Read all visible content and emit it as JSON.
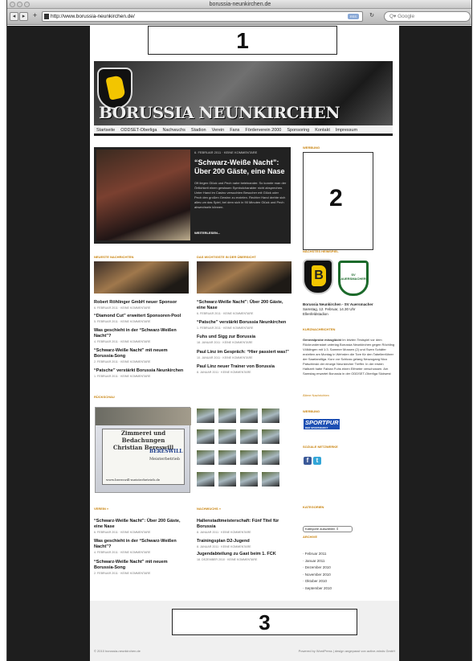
{
  "window": {
    "title": "borussia-neunkirchen.de"
  },
  "toolbar": {
    "url": "http://www.borussia-neunkirchen.de/",
    "rss_label": "RSS",
    "search_placeholder": "Q▾ Google"
  },
  "markers": {
    "one": "1",
    "two": "2",
    "three": "3"
  },
  "site": {
    "brand": "BORUSSIA NEUNKIRCHEN"
  },
  "nav": [
    "Startseite",
    "ODDSET-Oberliga",
    "Nachwuchs",
    "Stadion",
    "Verein",
    "Fans",
    "Förderverein 2000",
    "Sponsoring",
    "Kontakt",
    "Impressum"
  ],
  "featured": {
    "meta": "6. FEBRUAR 2011 · KEINE KOMMENTARE",
    "title": "“Schwarz-Weiße Nacht”: Über 200 Gäste, eine Nase",
    "excerpt": "Oft liegen Glück und Pech nahe beieinander. So konnte man der Örtlichkeit einen gewissen Symbolcharakter nicht absprechen. Unter Hand im Casino versuchten Besucher mit Glück oder Pech den großen Gewinn zu erzielen. Rechter Hand drehte sich alles um das Spiel, bei dem sich in 90 Minuten Glück und Pech abwechseln können.",
    "more": "WEITERLESEN..."
  },
  "sections": {
    "latest": "NEUESTE NACHRICHTEN",
    "overview": "DAS WICHTIGSTE IN DER ÜBERSICHT",
    "review": "RÜCKSCHAU",
    "club": "VEREIN »",
    "youth": "NACHWUCHS »",
    "ad": "WERBUNG",
    "next_game": "NÄCHSTES HEIMSPIEL",
    "short_news": "KURZNACHRICHTEN",
    "ad2": "WERBUNG",
    "social": "SOZIALE NETZWERKE",
    "categories": "KATEGORIEN",
    "archive": "ARCHIVE"
  },
  "latest_posts": [
    {
      "title": "Robert Röhlinger GmbH neuer Sponsor",
      "meta": "6. FEBRUAR 2011 · KEINE KOMMENTARE"
    },
    {
      "title": "“Diamond Cut” erweitert Sponsoren-Pool",
      "meta": "5. FEBRUAR 2011 · KEINE KOMMENTARE"
    },
    {
      "title": "Was geschieht in der “Schwarz-Weißen Nacht”?",
      "meta": "4. FEBRUAR 2011 · KEINE KOMMENTARE"
    },
    {
      "title": "“Schwarz-Weiße Nacht” mit neuem Borussia-Song",
      "meta": "2. FEBRUAR 2011 · KEINE KOMMENTARE"
    },
    {
      "title": "“Patsche” verstärkt Borussia Neunkirchen",
      "meta": "1. FEBRUAR 2011 · KEINE KOMMENTARE"
    }
  ],
  "overview_posts": [
    {
      "title": "“Schwarz-Weiße Nacht”: Über 200 Gäste, eine Nase",
      "meta": "6. FEBRUAR 2011 · KEINE KOMMENTARE"
    },
    {
      "title": "“Patsche” verstärkt Borussia Neunkirchen",
      "meta": "1. FEBRUAR 2011 · KEINE KOMMENTARE"
    },
    {
      "title": "Fuhs und Sigg zur Borussia",
      "meta": "18. JANUAR 2011 · KEINE KOMMENTARE"
    },
    {
      "title": "Paul Linz im Gespräch: “Hier passiert was!”",
      "meta": "10. JANUAR 2011 · KEINE KOMMENTARE"
    },
    {
      "title": "Paul Linz neuer Trainer von Borussia",
      "meta": "8. JANUAR 2011 · KEINE KOMMENTARE"
    }
  ],
  "review_image": {
    "line1": "Zimmerei und Bedachungen",
    "line2": "Christian Bereswill",
    "logo": "BERESWILL",
    "sub": "Meisterbetrieb",
    "web": "www.bereswill-meisterbetrieb.de"
  },
  "club_posts": [
    {
      "title": "“Schwarz-Weiße Nacht”: Über 200 Gäste, eine Nase",
      "meta": "6. FEBRUAR 2011 · KEINE KOMMENTARE"
    },
    {
      "title": "Was geschieht in der “Schwarz-Weißen Nacht”?",
      "meta": "4. FEBRUAR 2011 · KEINE KOMMENTARE"
    },
    {
      "title": "“Schwarz-Weiße Nacht” mit neuem Borussia-Song",
      "meta": "2. FEBRUAR 2011 · KEINE KOMMENTARE"
    }
  ],
  "youth_posts": [
    {
      "title": "Hallenstadtmeisterschaft: Fünf Titel für Borussia",
      "meta": "8. JANUAR 2011 · KEINE KOMMENTARE"
    },
    {
      "title": "Trainingsplan D2-Jugend",
      "meta": "8. JANUAR 2011 · KEINE KOMMENTARE"
    },
    {
      "title": "Jugendabteilung zu Gast beim 1. FCK",
      "meta": "18. DEZEMBER 2010 · KEINE KOMMENTARE"
    }
  ],
  "next_game": {
    "home_logo": "B",
    "away_logo": "SV AUERSMACHER",
    "match": "Borussia Neunkirchen - SV Auersmacher",
    "when": "Samstag, 12. Februar, 14.30 Uhr",
    "venue": "Ellenfeldstadion"
  },
  "short_news": {
    "lead": "Generalprobe missglückt",
    "text": "Im letzten Testspiel vor dem Rückrundenstart unterlag Borussia Neunkirchen gegen Röchling Völklingen mit 1:3. Sammer Mossen (2) und Swen Schäfer erzielten am Montag in Wehrden die Tore für den Tabellenführer der Saarlandliga. Kurz vor Schluss gelang Neuzugang Nico Patschinski der einzige Neunkircher Treffer. In der ersten Halbzeit hatte Fabian Fuhs einen Elfmeter verschossen. Am Samstag erwartet Borussia in der ODDSET-Oberliga Südwest",
    "older": "Ältere Nachrichten"
  },
  "ad2": {
    "label": "SPORTPUR",
    "sub": "DER SPORTMARKT"
  },
  "social": {
    "facebook": "f",
    "twitter": "t"
  },
  "categories": {
    "selected": "Kategorie auswählen"
  },
  "archive": [
    "Februar 2011",
    "Januar 2011",
    "Dezember 2010",
    "November 2010",
    "Oktober 2010",
    "September 2010"
  ],
  "footer": {
    "left": "© 2010 borussia-neunkirchen.de",
    "right": "Powered by WordPress | design angepasst von active-minds GmbH"
  }
}
